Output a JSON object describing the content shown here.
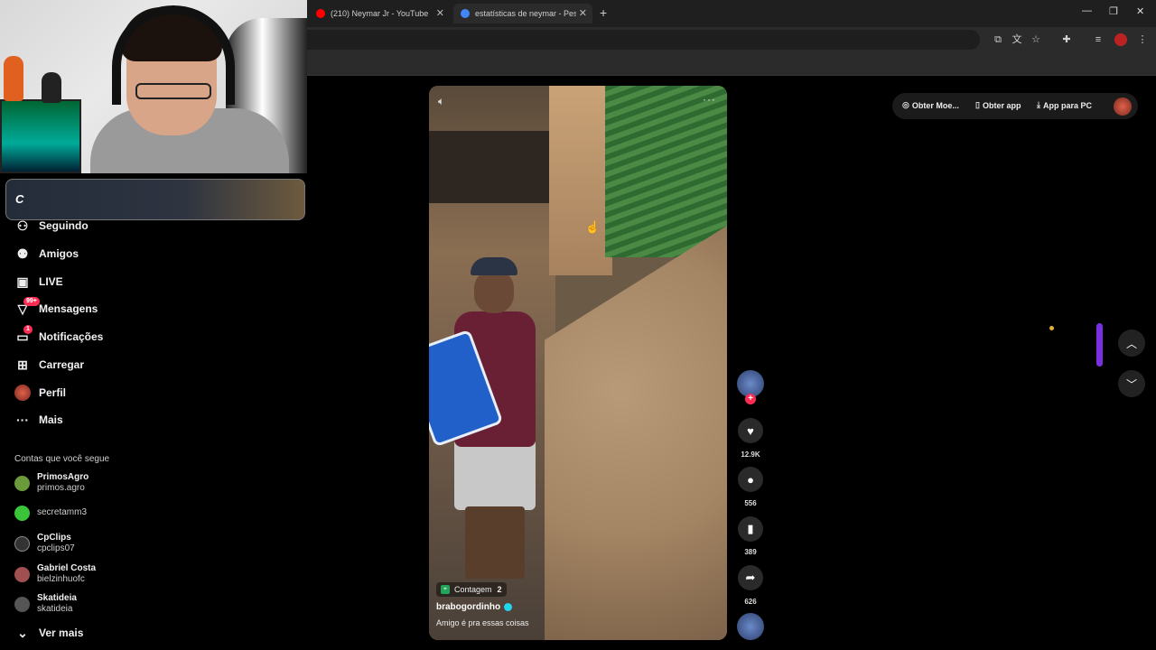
{
  "browser": {
    "tabs": [
      {
        "title": "(210) Neymar Jr - YouTube",
        "favicon_color": "#ff0000",
        "active": false
      },
      {
        "title": "estatísticas de neymar - Pesqui",
        "favicon_color": "#4285f4",
        "active": true
      }
    ],
    "new_tab": "+",
    "window_controls": {
      "minimize": "—",
      "restore": "❐",
      "close": "✕"
    }
  },
  "sidebar": {
    "nav": [
      {
        "label": "Seguindo",
        "icon": "user-follow-icon"
      },
      {
        "label": "Amigos",
        "icon": "friends-icon"
      },
      {
        "label": "LIVE",
        "icon": "live-tv-icon"
      },
      {
        "label": "Mensagens",
        "icon": "message-icon",
        "badge": "99+"
      },
      {
        "label": "Notificações",
        "icon": "notification-icon",
        "badge": "1"
      },
      {
        "label": "Carregar",
        "icon": "upload-icon"
      },
      {
        "label": "Perfil",
        "icon": "profile-avatar"
      },
      {
        "label": "Mais",
        "icon": "more-icon"
      }
    ],
    "following_title": "Contas que você segue",
    "accounts": [
      {
        "name": "PrimosAgro",
        "handle": "primos.agro"
      },
      {
        "name": "",
        "handle": "secretamm3"
      },
      {
        "name": "CpClips",
        "handle": "cpclips07"
      },
      {
        "name": "Gabriel Costa",
        "handle": "bielzinhuofc"
      },
      {
        "name": "Skatideia",
        "handle": "skatideia"
      }
    ],
    "see_more": "Ver mais"
  },
  "video": {
    "location": "Contagem",
    "location_count": "2",
    "author": "brabogordinho",
    "description": "Amigo é pra essas coisas"
  },
  "actions": {
    "likes": "12.9K",
    "comments": "556",
    "saves": "389",
    "shares": "626"
  },
  "topbar": {
    "coins": "Obter Moe...",
    "get_app": "Obter app",
    "pc_app": "App para PC"
  },
  "colors": {
    "accent": "#fe2c55",
    "scroll_thumb": "#7a30e0"
  }
}
